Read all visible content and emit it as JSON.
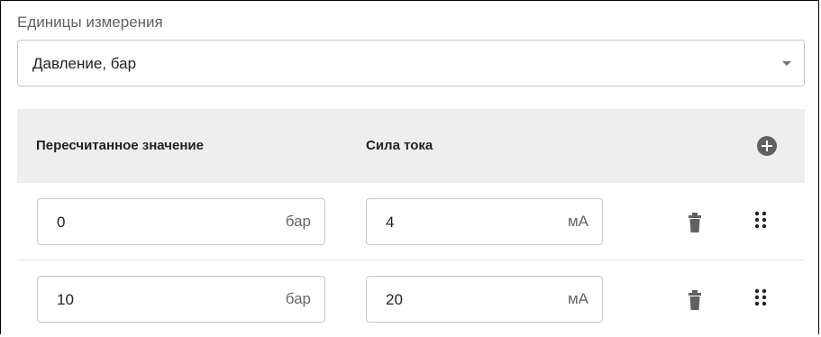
{
  "units": {
    "label": "Единицы измерения",
    "selected": "Давление, бар"
  },
  "table": {
    "headers": {
      "recalculated": "Пересчитанное значение",
      "current": "Сила тока"
    },
    "rows": [
      {
        "recalculated_value": "0",
        "recalculated_unit": "бар",
        "current_value": "4",
        "current_unit": "мА"
      },
      {
        "recalculated_value": "10",
        "recalculated_unit": "бар",
        "current_value": "20",
        "current_unit": "мА"
      }
    ]
  },
  "icons": {
    "add": "plus-circle-icon",
    "delete": "trash-icon",
    "reorder": "drag-handle-icon"
  },
  "colors": {
    "header_bg": "#eeeeee",
    "icon": "#616161",
    "border": "#c8c8c8"
  }
}
